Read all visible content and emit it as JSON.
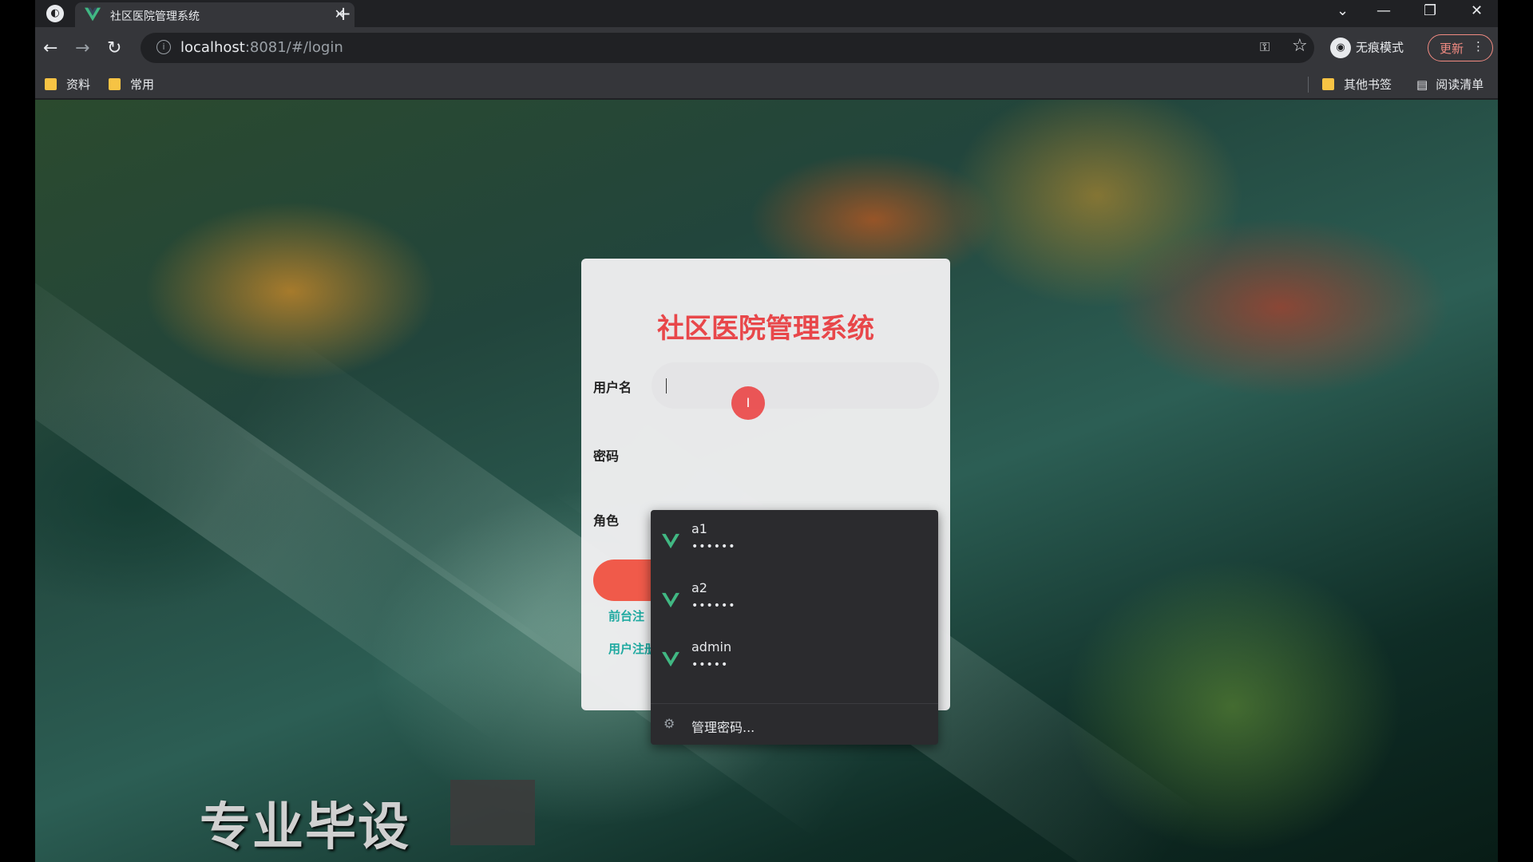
{
  "browser": {
    "tab_title": "社区医院管理系统",
    "tab_close": "✕",
    "new_tab": "+",
    "url_host": "localhost",
    "url_rest": ":8081/#/login",
    "incognito_label": "无痕模式",
    "update_label": "更新",
    "window_controls": {
      "tabsearch": "⌄",
      "minimize": "—",
      "restore": "❐",
      "close": "✕"
    },
    "nav": {
      "back": "←",
      "forward": "→",
      "reload": "↻"
    }
  },
  "bookmarks": {
    "left": [
      "资料",
      "常用"
    ],
    "other": "其他书签",
    "reading_list": "阅读清单"
  },
  "login": {
    "title": "社区医院管理系统",
    "username_label": "用户名",
    "password_label": "密码",
    "role_label": "角色",
    "link_front_register": "前台注",
    "link_user_register": "用户注册"
  },
  "autofill": {
    "items": [
      {
        "username": "a1",
        "password": "••••••"
      },
      {
        "username": "a2",
        "password": "••••••"
      },
      {
        "username": "admin",
        "password": "•••••"
      }
    ],
    "manage_label": "管理密码..."
  },
  "watermark": {
    "text": "专业毕设"
  },
  "icons": {
    "vue_logo": "vue-logo-icon",
    "key": "key-icon",
    "star": "star-icon",
    "folder": "folder-icon",
    "gear": "gear-icon"
  },
  "colors": {
    "title_red": "#e8474a",
    "button_red": "#f05a4a",
    "link_teal": "#1ea9a0",
    "vue_green": "#41b883"
  }
}
